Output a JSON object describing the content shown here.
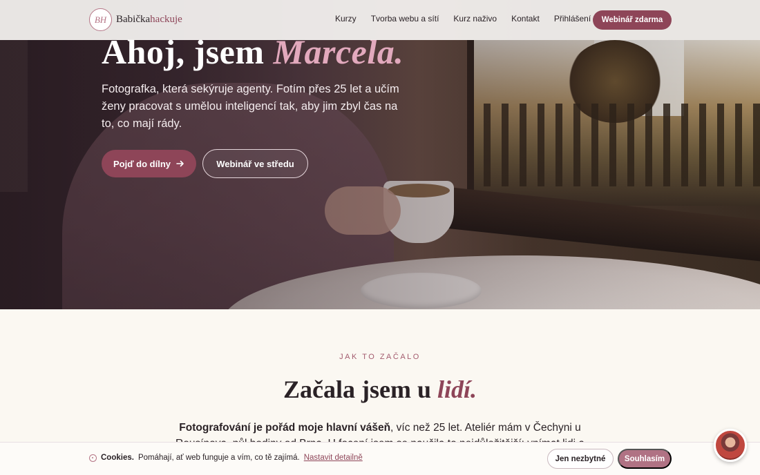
{
  "header": {
    "logo_mark": "BH",
    "logo_part1": "Babička",
    "logo_part2": "hackuje",
    "nav": [
      "Kurzy",
      "Tvorba webu a sítí",
      "Kurz naživo",
      "Kontakt",
      "Přihlášení"
    ],
    "cta": "Webinář zdarma"
  },
  "hero": {
    "title_plain": "Ahoj, jsem ",
    "title_accent": "Marcela.",
    "text": "Fotografka, která sekýruje agenty. Fotím přes 25 let a učím ženy pracovat s umělou inteligencí tak, aby jim zbyl čas na to, co mají rády.",
    "primary_button": "Pojď do dílny",
    "primary_icon": "arrow-right-icon",
    "secondary_button": "Webinář ve středu"
  },
  "section": {
    "eyebrow": "JAK TO ZAČALO",
    "title_plain": "Začala jsem u ",
    "title_accent": "lidí.",
    "body_bold": "Fotografování je pořád moje hlavní vášeň",
    "body_rest": ", víc než 25 let. Ateliér mám v Čechyni u Rousínova, půl hodiny od Brna. U focení jsem se naučila to nejdůležitější: vnímat lidi a vytvořit"
  },
  "cookie": {
    "label": "Cookies.",
    "text": "Pomáhají, ať web funguje a vím, co tě zajímá.",
    "link": "Nastavit detailně",
    "necessary_button": "Jen nezbytné",
    "accept_button": "Souhlasím"
  },
  "colors": {
    "brand": "#8e4558",
    "accent_pink": "#e2a9bd",
    "background": "#fbf8f2"
  }
}
